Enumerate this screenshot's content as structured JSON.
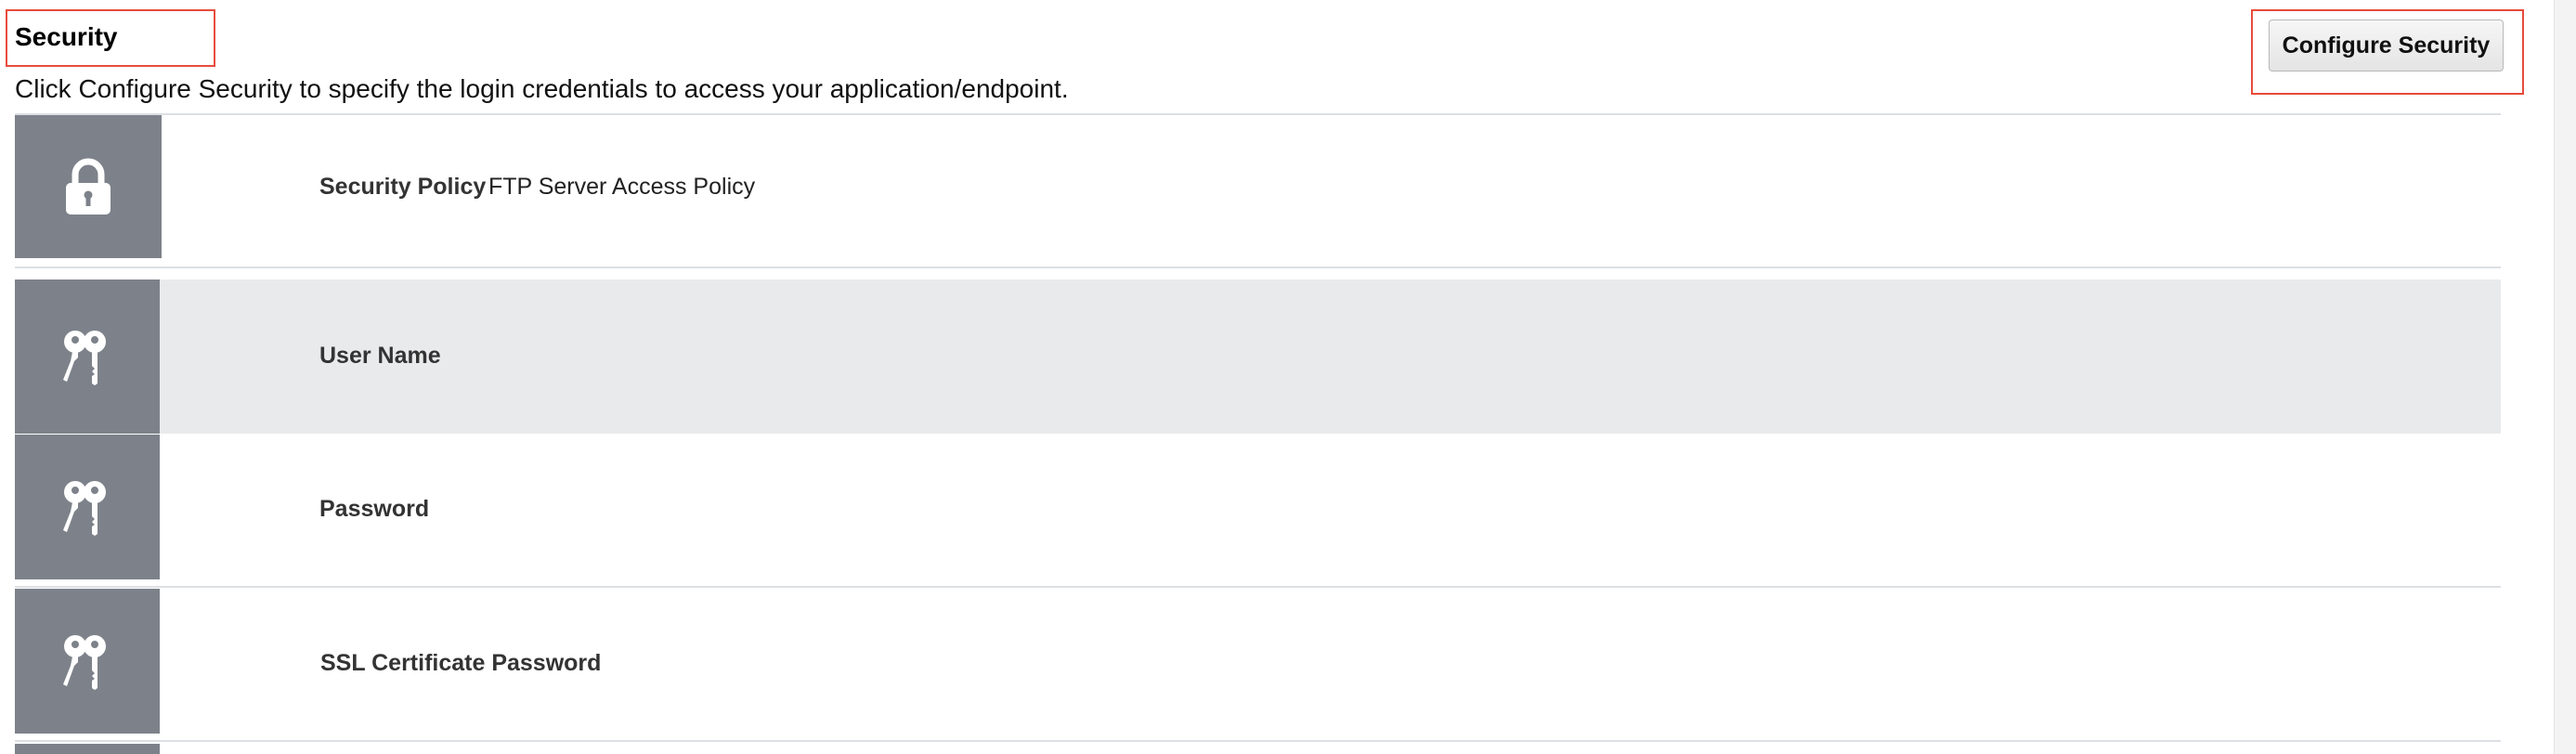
{
  "section": {
    "title": "Security",
    "description": "Click Configure Security to specify the login credentials to access your application/endpoint.",
    "configure_button_label": "Configure Security"
  },
  "rows": [
    {
      "icon": "lock-icon",
      "label": "Security Policy",
      "value": "FTP Server Access Policy"
    },
    {
      "icon": "keys-icon",
      "label": "User Name",
      "value": ""
    },
    {
      "icon": "keys-icon",
      "label": "Password",
      "value": ""
    },
    {
      "icon": "keys-icon",
      "label": "SSL Certificate Password",
      "value": ""
    }
  ],
  "colors": {
    "highlight_border": "#e74c3c",
    "icon_tile": "#7d828a",
    "selected_row": "#e9eaec"
  }
}
